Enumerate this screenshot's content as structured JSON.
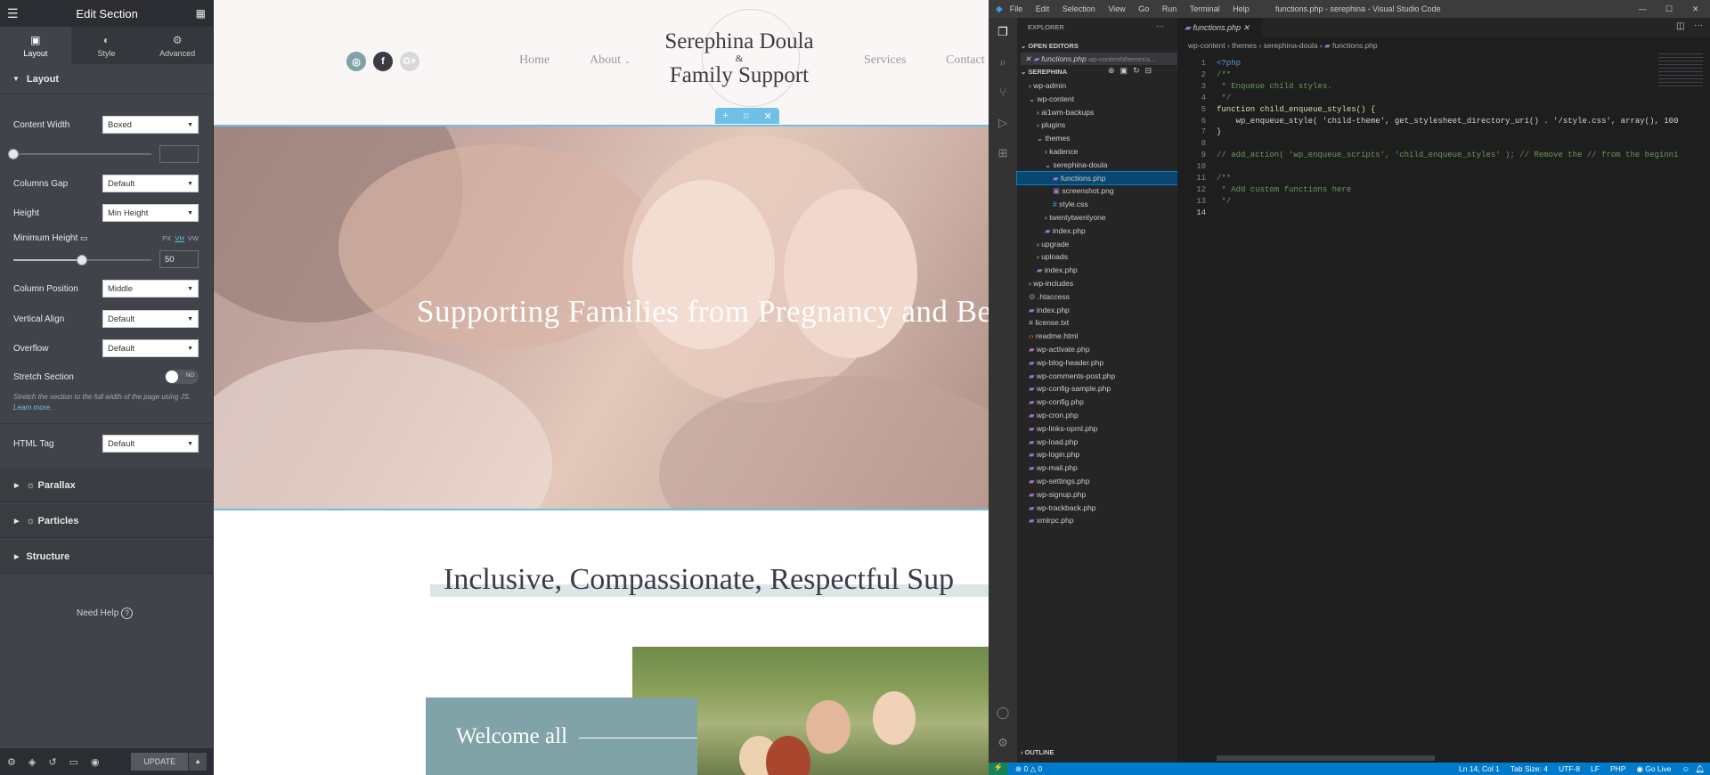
{
  "elementor": {
    "title": "Edit Section",
    "tabs": [
      {
        "label": "Layout"
      },
      {
        "label": "Style"
      },
      {
        "label": "Advanced"
      }
    ],
    "section_title": "Layout",
    "fields": {
      "content_width": {
        "label": "Content Width",
        "value": "Boxed"
      },
      "columns_gap": {
        "label": "Columns Gap",
        "value": "Default"
      },
      "height": {
        "label": "Height",
        "value": "Min Height"
      },
      "min_height": {
        "label": "Minimum Height",
        "units": [
          "PX",
          "VH",
          "VW"
        ],
        "value": "50"
      },
      "column_position": {
        "label": "Column Position",
        "value": "Middle"
      },
      "vertical_align": {
        "label": "Vertical Align",
        "value": "Default"
      },
      "overflow": {
        "label": "Overflow",
        "value": "Default"
      },
      "stretch": {
        "label": "Stretch Section",
        "toggle": "NO",
        "note": "Stretch the section to the full width of the page using JS.",
        "note_link": "Learn more."
      },
      "html_tag": {
        "label": "HTML Tag",
        "value": "Default"
      }
    },
    "collapsibles": [
      "Parallax",
      "Particles",
      "Structure"
    ],
    "help": "Need Help",
    "update": "UPDATE"
  },
  "site": {
    "logo_line1": "Serephina Doula",
    "logo_amp": "&",
    "logo_line2": "Family Support",
    "nav": [
      "Home",
      "About",
      "Services",
      "Contact"
    ],
    "hero_title": "Supporting Families from Pregnancy and Be",
    "tagline": "Inclusive, Compassionate, Respectful Sup",
    "welcome": "Welcome all",
    "colors": {
      "accent": "#6ec1e4",
      "teal": "#7fa3a7"
    }
  },
  "vscode": {
    "menu": [
      "File",
      "Edit",
      "Selection",
      "View",
      "Go",
      "Run",
      "Terminal",
      "Help"
    ],
    "window_title": "functions.php - serephina - Visual Studio Code",
    "explorer": "EXPLORER",
    "open_editors": "OPEN EDITORS",
    "open_file": "functions.php",
    "open_file_path": "wp-content\\themes\\s...",
    "project": "SEREPHINA",
    "tree": [
      {
        "name": "wp-admin",
        "depth": 1,
        "type": "folder",
        "open": false
      },
      {
        "name": "wp-content",
        "depth": 1,
        "type": "folder",
        "open": true
      },
      {
        "name": "ai1wm-backups",
        "depth": 2,
        "type": "folder",
        "open": false
      },
      {
        "name": "plugins",
        "depth": 2,
        "type": "folder",
        "open": false
      },
      {
        "name": "themes",
        "depth": 2,
        "type": "folder",
        "open": true
      },
      {
        "name": "kadence",
        "depth": 3,
        "type": "folder",
        "open": false
      },
      {
        "name": "serephina-doula",
        "depth": 3,
        "type": "folder",
        "open": true
      },
      {
        "name": "functions.php",
        "depth": 4,
        "type": "php",
        "selected": true
      },
      {
        "name": "screenshot.png",
        "depth": 4,
        "type": "img"
      },
      {
        "name": "style.css",
        "depth": 4,
        "type": "css"
      },
      {
        "name": "twentytwentyone",
        "depth": 3,
        "type": "folder",
        "open": false
      },
      {
        "name": "index.php",
        "depth": 3,
        "type": "php"
      },
      {
        "name": "upgrade",
        "depth": 2,
        "type": "folder",
        "open": false
      },
      {
        "name": "uploads",
        "depth": 2,
        "type": "folder",
        "open": false
      },
      {
        "name": "index.php",
        "depth": 2,
        "type": "php"
      },
      {
        "name": "wp-includes",
        "depth": 1,
        "type": "folder",
        "open": false
      },
      {
        "name": ".htaccess",
        "depth": 1,
        "type": "cfg"
      },
      {
        "name": "index.php",
        "depth": 1,
        "type": "php"
      },
      {
        "name": "license.txt",
        "depth": 1,
        "type": "txt"
      },
      {
        "name": "readme.html",
        "depth": 1,
        "type": "html"
      },
      {
        "name": "wp-activate.php",
        "depth": 1,
        "type": "php"
      },
      {
        "name": "wp-blog-header.php",
        "depth": 1,
        "type": "php"
      },
      {
        "name": "wp-comments-post.php",
        "depth": 1,
        "type": "php"
      },
      {
        "name": "wp-config-sample.php",
        "depth": 1,
        "type": "php"
      },
      {
        "name": "wp-config.php",
        "depth": 1,
        "type": "php"
      },
      {
        "name": "wp-cron.php",
        "depth": 1,
        "type": "php"
      },
      {
        "name": "wp-links-opml.php",
        "depth": 1,
        "type": "php"
      },
      {
        "name": "wp-load.php",
        "depth": 1,
        "type": "php"
      },
      {
        "name": "wp-login.php",
        "depth": 1,
        "type": "php"
      },
      {
        "name": "wp-mail.php",
        "depth": 1,
        "type": "php"
      },
      {
        "name": "wp-settings.php",
        "depth": 1,
        "type": "php"
      },
      {
        "name": "wp-signup.php",
        "depth": 1,
        "type": "php"
      },
      {
        "name": "wp-trackback.php",
        "depth": 1,
        "type": "php"
      },
      {
        "name": "xmlrpc.php",
        "depth": 1,
        "type": "php"
      }
    ],
    "outline": "OUTLINE",
    "tab": "functions.php",
    "breadcrumb": [
      "wp-content",
      "themes",
      "serephina-doula",
      "functions.php"
    ],
    "code": [
      "<?php",
      "/**",
      " * Enqueue child styles.",
      " */",
      "function child_enqueue_styles() {",
      "    wp_enqueue_style( 'child-theme', get_stylesheet_directory_uri() . '/style.css', array(), 100",
      "}",
      "",
      "// add_action( 'wp_enqueue_scripts', 'child_enqueue_styles' ); // Remove the // from the beginni",
      "",
      "/**",
      " * Add custom functions here",
      " */",
      ""
    ],
    "status": {
      "errors": "0",
      "warnings": "0",
      "pos": "Ln 14, Col 1",
      "tab": "Tab Size: 4",
      "enc": "UTF-8",
      "eol": "LF",
      "lang": "PHP",
      "golive": "Go Live"
    }
  }
}
